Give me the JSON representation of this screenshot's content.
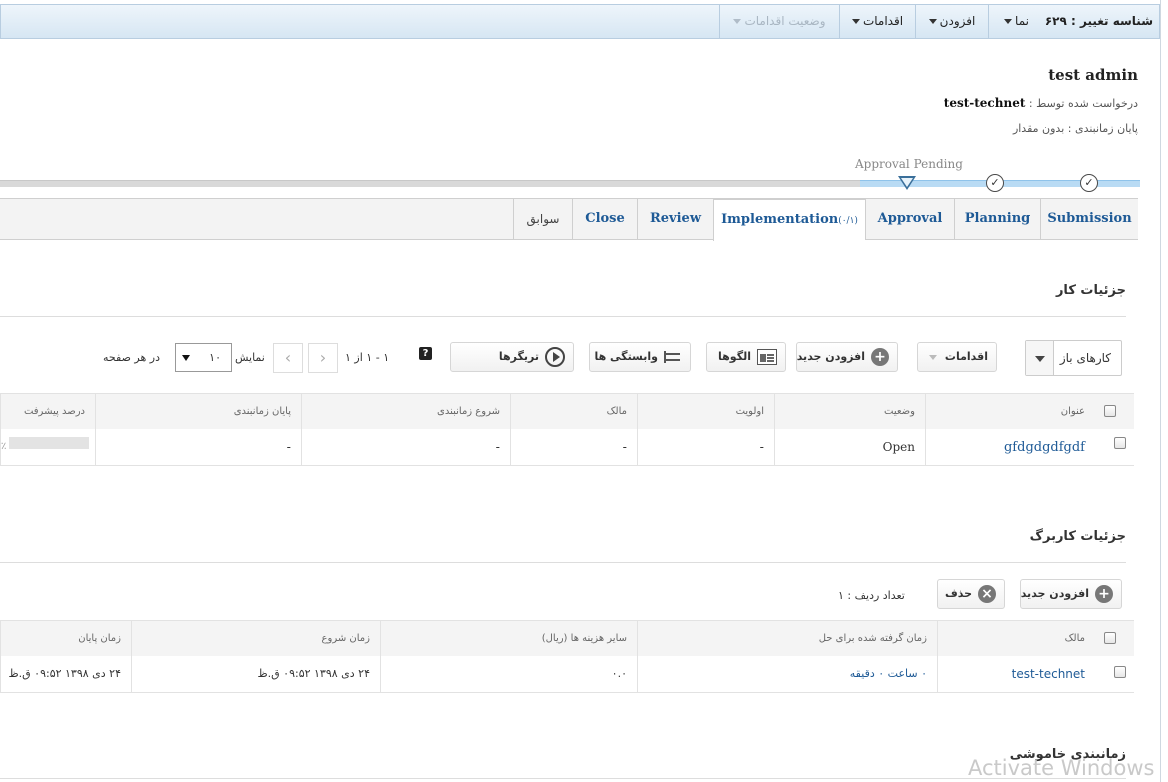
{
  "toolbar": {
    "change_id": "شناسه تغییر : ۶۲۹",
    "view": "نما",
    "add": "افزودن",
    "actions": "اقدامات",
    "actions_status": "وضعیت اقدامات"
  },
  "header": {
    "title": "test admin",
    "requested_by_label": "درخواست شده توسط :",
    "requested_by_value": "test-technet",
    "schedule_end": "پایان زمانبندی : بدون مقدار"
  },
  "progress": {
    "current_stage": "Approval Pending",
    "completed_stages": 2
  },
  "tabs": [
    {
      "label": "Submission"
    },
    {
      "label": "Planning"
    },
    {
      "label": "Approval"
    },
    {
      "label": "Implementation",
      "count": "(۰/۱)"
    },
    {
      "label": "Review"
    },
    {
      "label": "Close"
    },
    {
      "label": "سوابق"
    }
  ],
  "tasks": {
    "section_title": "جزئیات کار",
    "filter_value": "کارهای باز",
    "actions_label": "اقدامات",
    "add_new_label": "افزودن جدید",
    "templates_label": "الگوها",
    "dependencies_label": "وابستگی ها",
    "triggers_label": "تریگرها",
    "pager_range": "۱ - ۱ از ۱",
    "show_label": "نمایش",
    "per_page_value": "۱۰",
    "per_page_label": "در هر صفحه",
    "columns": [
      "عنوان",
      "وضعیت",
      "اولویت",
      "مالک",
      "شروع زمانبندی",
      "پایان زمانبندی",
      "درصد پیشرفت"
    ],
    "rows": [
      {
        "title": "gfdgdgdfgdf",
        "status": "Open",
        "priority": "-",
        "owner": "-",
        "start": "-",
        "end": "-",
        "progress": 0,
        "progress_text": "٪"
      }
    ]
  },
  "worklog": {
    "section_title": "جزئیات کاربرگ",
    "add_new_label": "افزودن جدید",
    "delete_label": "حذف",
    "row_count": "تعداد ردیف : ۱",
    "columns": [
      "مالک",
      "زمان گرفته شده برای حل",
      "سایر هزینه ها (ریال)",
      "زمان شروع",
      "زمان پایان"
    ],
    "rows": [
      {
        "owner": "test-technet",
        "time_taken": "۰ ساعت ۰ دقیقه",
        "other_cost": "۰.۰",
        "start": "۲۴ دی ۱۳۹۸ ۰۹:۵۲ ق.ظ",
        "end": "۲۴ دی ۱۳۹۸ ۰۹:۵۲ ق.ظ"
      }
    ]
  },
  "downtime": {
    "section_title": "زمانبندی خاموشی"
  },
  "watermark": "Activate Windows"
}
